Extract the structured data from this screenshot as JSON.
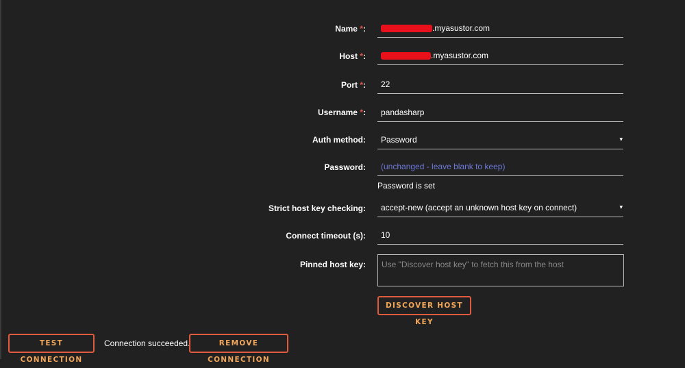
{
  "form": {
    "name": {
      "label": "Name",
      "required_mark": "*",
      "suffix": ":",
      "value_suffix": ".myasustor.com"
    },
    "host": {
      "label": "Host",
      "required_mark": "*",
      "suffix": ":",
      "value_suffix": ".myasustor.com"
    },
    "port": {
      "label": "Port",
      "required_mark": "*",
      "suffix": ":",
      "value": "22"
    },
    "username": {
      "label": "Username",
      "required_mark": "*",
      "suffix": ":",
      "value": "pandasharp"
    },
    "auth_method": {
      "label": "Auth method:",
      "value": "Password",
      "caret": "▾"
    },
    "password": {
      "label": "Password:",
      "placeholder": "(unchanged - leave blank to keep)",
      "hint": "Password is set"
    },
    "strict_host_key": {
      "label": "Strict host key checking:",
      "value": "accept-new (accept an unknown host key on connect)",
      "caret": "▾"
    },
    "connect_timeout": {
      "label": "Connect timeout (s):",
      "value": "10"
    },
    "pinned_host_key": {
      "label": "Pinned host key:",
      "placeholder": "Use \"Discover host key\" to fetch this from the host"
    },
    "discover_button": "DISCOVER HOST KEY"
  },
  "footer": {
    "test_button": "TEST CONNECTION",
    "status": "Connection succeeded.",
    "remove_button": "REMOVE CONNECTION"
  },
  "colors": {
    "background": "#222122",
    "required": "#e0534c",
    "button_border": "#e05a3e",
    "button_text": "#f2a65a",
    "placeholder_link": "#6b78d8",
    "redaction": "#e8101a"
  }
}
